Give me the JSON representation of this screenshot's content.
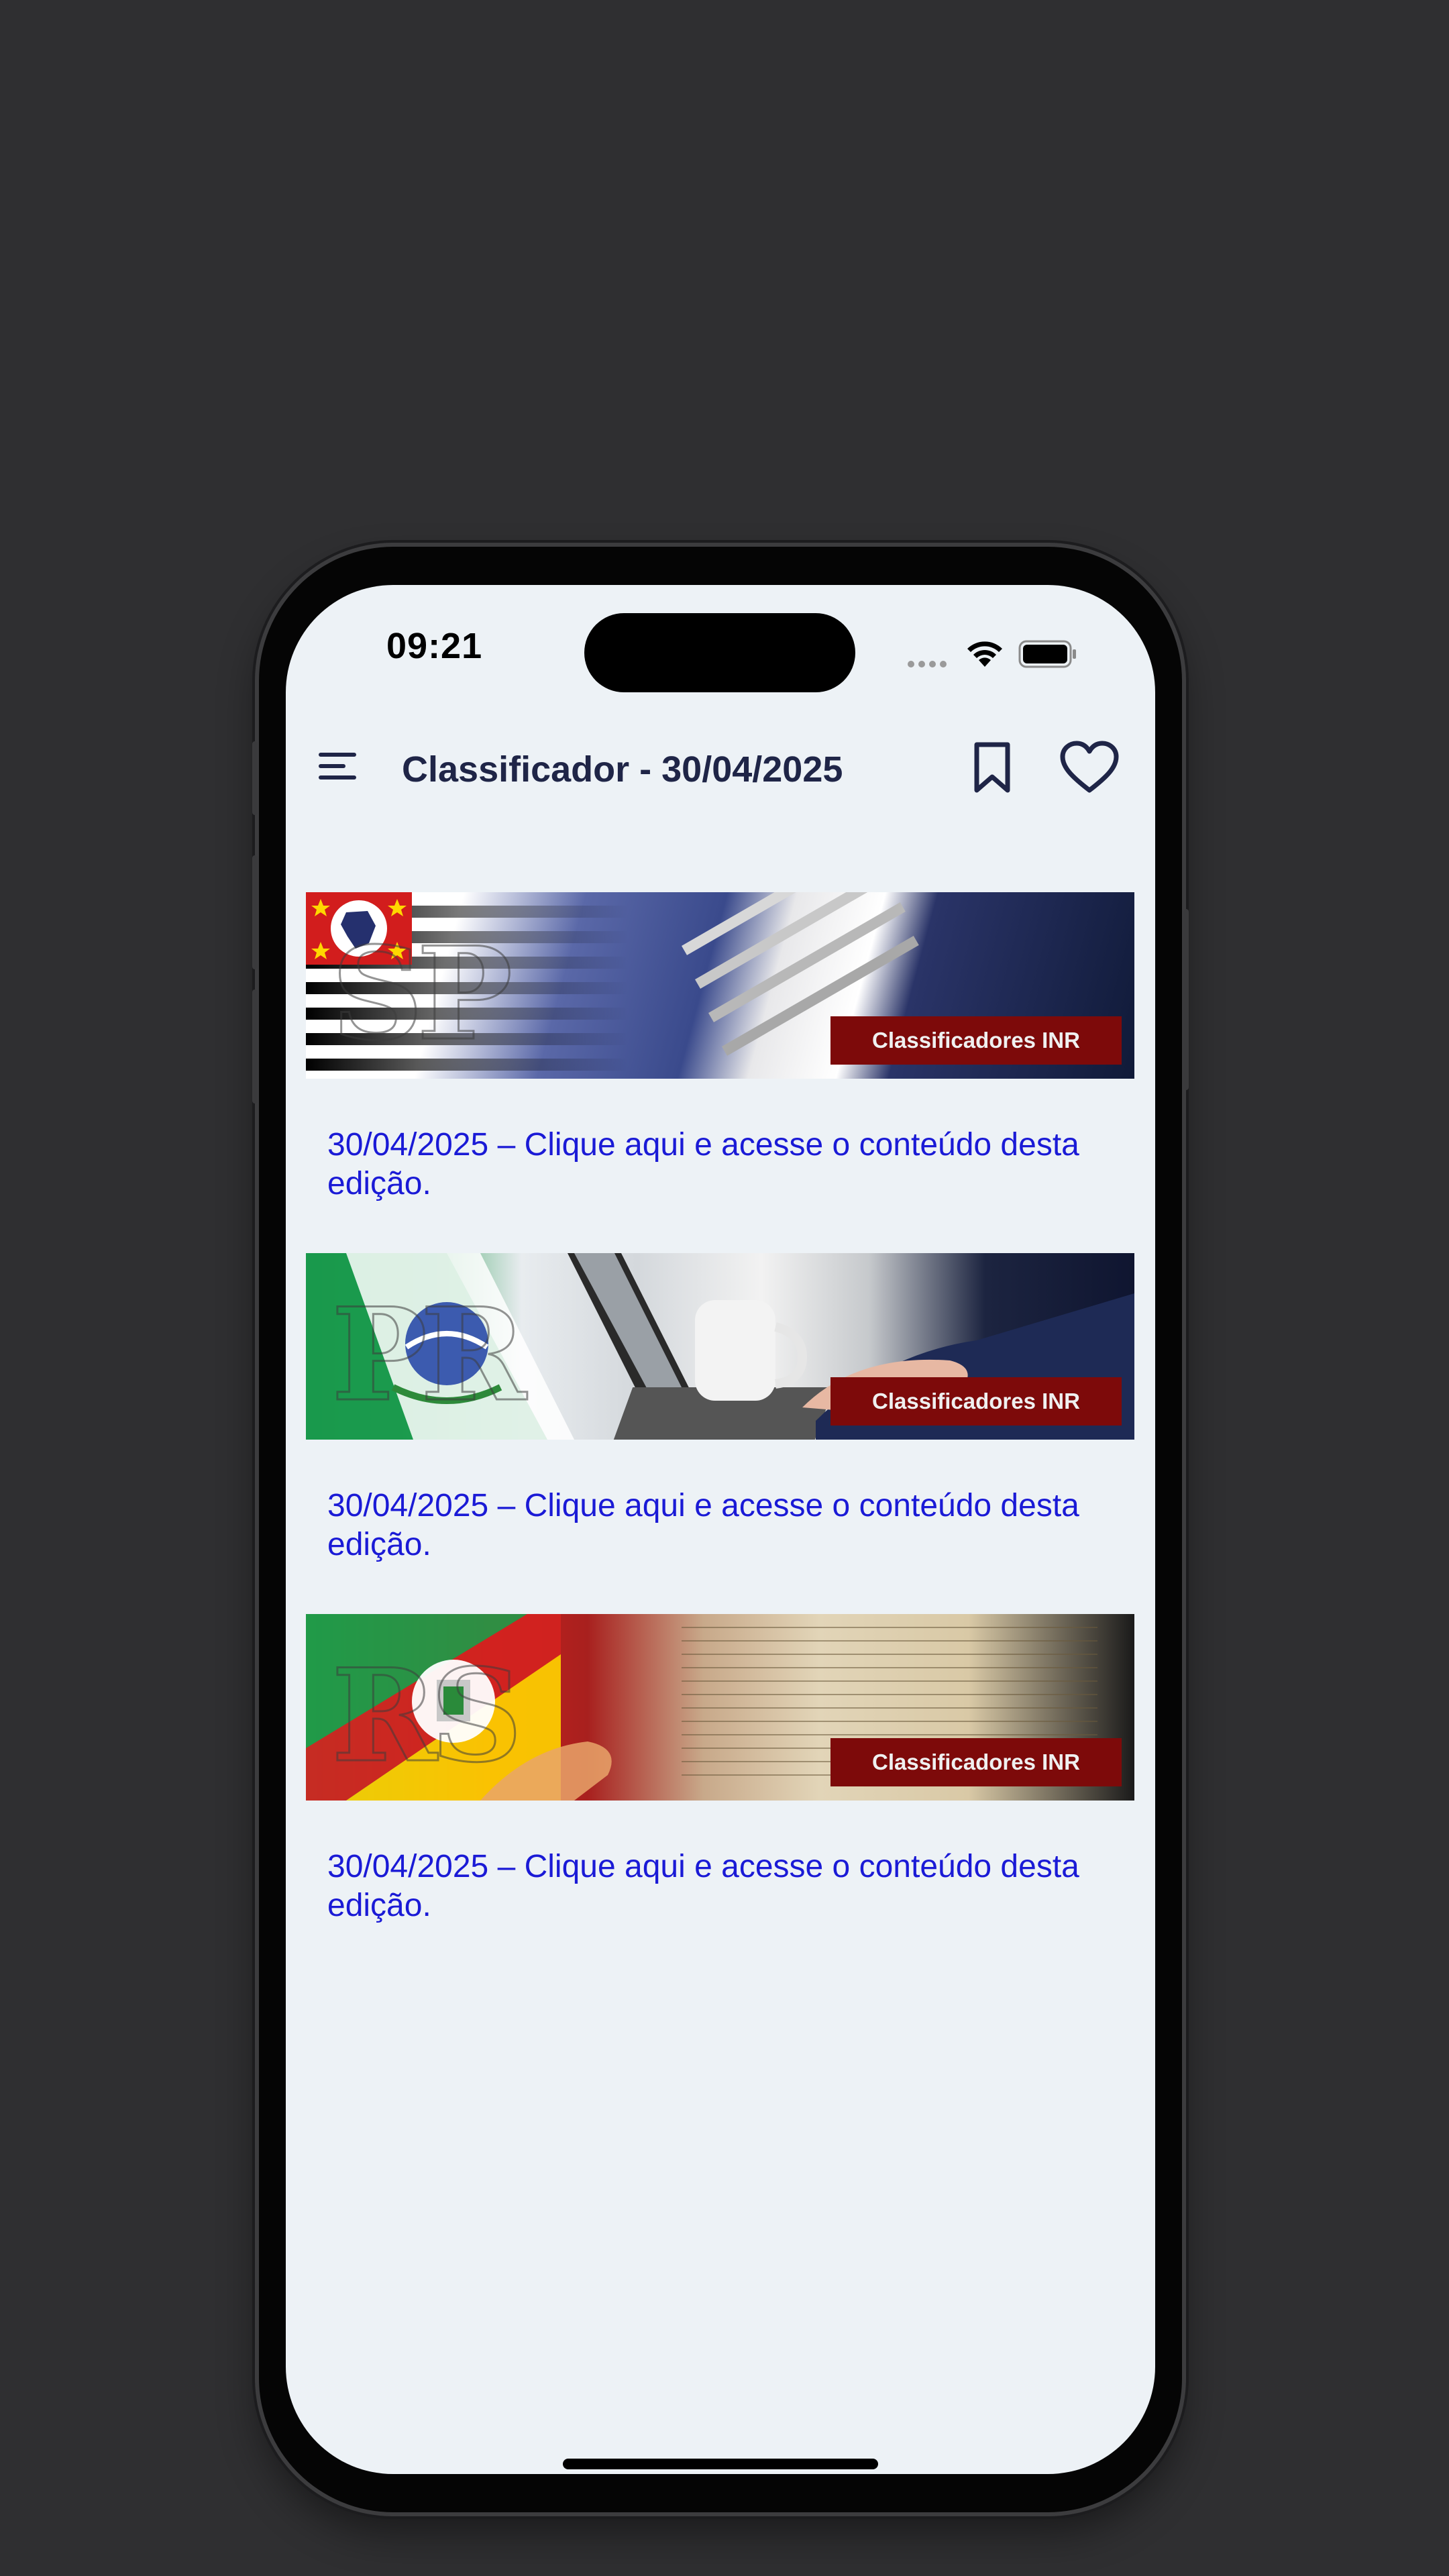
{
  "status_bar": {
    "time": "09:21"
  },
  "appbar": {
    "title": "Classificador - 30/04/2025",
    "icons": [
      "menu-icon",
      "bookmark-icon",
      "heart-icon"
    ]
  },
  "feed": {
    "items": [
      {
        "banner_tag": "Classificadores INR",
        "banner_letters": "SP",
        "link_text": "30/04/2025 – Clique aqui e acesse o conteúdo desta edição."
      },
      {
        "banner_tag": "Classificadores INR",
        "banner_letters": "PR",
        "link_text": "30/04/2025 – Clique aqui e acesse o conteúdo desta edição."
      },
      {
        "banner_tag": "Classificadores INR",
        "banner_letters": "RS",
        "link_text": "30/04/2025 – Clique aqui e acesse o conteúdo desta edição."
      }
    ]
  },
  "colors": {
    "background": "#2f2f31",
    "screen": "#edf2f6",
    "title": "#1f2547",
    "link": "#1a1ad6",
    "tag": "#7d0a0a"
  }
}
